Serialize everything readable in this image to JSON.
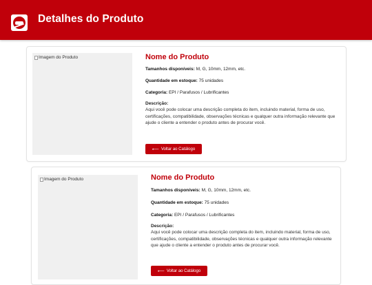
{
  "header": {
    "title": "Detalhes do Produto",
    "logo_icon": "brand-logo-icon",
    "background_color": "#c0000a"
  },
  "products": [
    {
      "image_alt": "Imagem do Produto",
      "name": "Nome do Produto",
      "sizes_label": "Tamanhos disponíveis:",
      "sizes_value": "M, G, 10mm, 12mm, etc.",
      "stock_label": "Quantidade em estoque:",
      "stock_value": "75 unidades",
      "category_label": "Categoria:",
      "category_value": "EPI / Parafusos / Lubrificantes",
      "description_label": "Descrição:",
      "description_text": "Aqui você pode colocar uma descrição completa do item, incluindo material, forma de uso, certificações, compatibilidade, observações técnicas e qualquer outra informação relevante que ajude o cliente a entender o produto antes de procurar você.",
      "back_button_label": "Voltar ao Catálogo",
      "back_button_icon": "arrow-left-icon"
    },
    {
      "image_alt": "Imagem do Produto",
      "name": "Nome do Produto",
      "sizes_label": "Tamanhos disponíveis:",
      "sizes_value": "M, G, 10mm, 12mm, etc.",
      "stock_label": "Quantidade em estoque:",
      "stock_value": "75 unidades",
      "category_label": "Categoria:",
      "category_value": "EPI / Parafusos / Lubrificantes",
      "description_label": "Descrição:",
      "description_text": "Aqui você pode colocar uma descrição completa do item, incluindo material, forma de uso, certificações, compatibilidade, observações técnicas e qualquer outra informação relevante que ajude o cliente a entender o produto antes de procurar você.",
      "back_button_label": "Voltar ao Catálogo",
      "back_button_icon": "arrow-left-icon"
    }
  ],
  "colors": {
    "accent": "#c0000a",
    "image_placeholder": "#f0f0f0"
  }
}
